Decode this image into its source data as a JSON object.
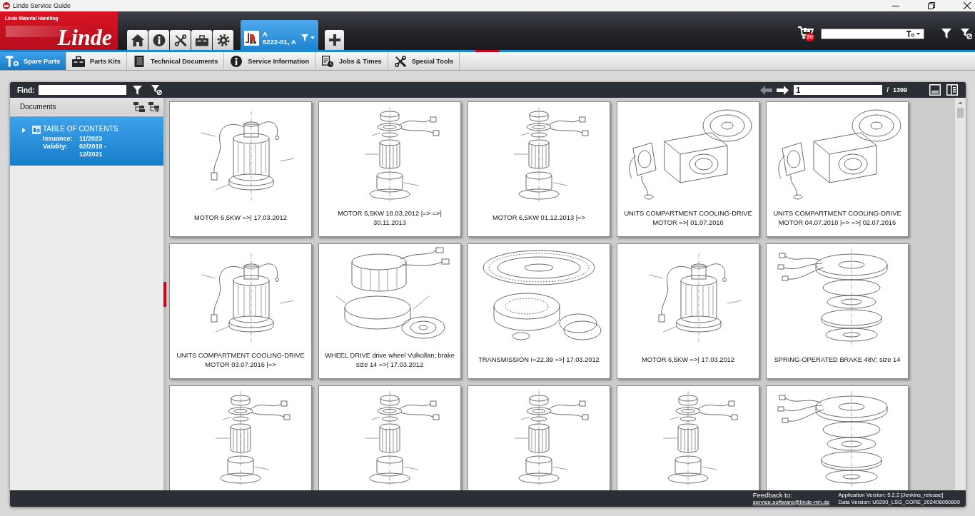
{
  "window": {
    "title": "Linde Service Guide"
  },
  "header": {
    "tagline": "Linde Material Handling",
    "logo": "Linde",
    "vehicle": {
      "model": "A",
      "serial": "5222-01, A"
    },
    "cart_count": "30"
  },
  "tabs": [
    {
      "label": "Spare Parts",
      "selected": true
    },
    {
      "label": "Parts Kits",
      "selected": false
    },
    {
      "label": "Technical Documents",
      "selected": false
    },
    {
      "label": "Service Information",
      "selected": false
    },
    {
      "label": "Jobs & Times",
      "selected": false
    },
    {
      "label": "Special Tools",
      "selected": false
    }
  ],
  "finder": {
    "label": "Find:"
  },
  "pager": {
    "back": {
      "disabled": true
    },
    "forward": {
      "disabled": false
    },
    "page": "1",
    "separator": "/",
    "total": "1399"
  },
  "sidebar": {
    "title": "Documents",
    "items": [
      {
        "title": "TABLE OF CONTENTS",
        "selected": true,
        "expanded": false,
        "fields": [
          {
            "label": "Issuance:",
            "value": "11/2023"
          },
          {
            "label": "Validity:",
            "value": "02/2010 - 12/2021"
          }
        ]
      }
    ]
  },
  "cards": [
    {
      "kind": "motor",
      "caption": "MOTOR 6,5KW =>| 17.03.2012"
    },
    {
      "kind": "stack",
      "caption": "MOTOR 6,5KW 18.03.2012 |=> =>| 30.11.2013"
    },
    {
      "kind": "stack",
      "caption": "MOTOR 6,5KW 01.12.2013 |=>"
    },
    {
      "kind": "housing",
      "caption": "UNITS COMPARTMENT COOLING-DRIVE MOTOR =>| 01.07.2010"
    },
    {
      "kind": "housing",
      "caption": "UNITS COMPARTMENT COOLING-DRIVE MOTOR 04.07.2010 |=> =>| 02.07.2016"
    },
    {
      "kind": "motor",
      "caption": "UNITS COMPARTMENT COOLING-DRIVE MOTOR 03.07.2016 |=>"
    },
    {
      "kind": "drive",
      "caption": "WHEEL DRIVE drive wheel Vulkollan; brake size 14 =>| 17.03.2012"
    },
    {
      "kind": "ring",
      "caption": "TRANSMISSION I=22,39 =>| 17.03.2012"
    },
    {
      "kind": "motor",
      "caption": "MOTOR 6,5KW =>| 17.03.2012"
    },
    {
      "kind": "discs",
      "caption": "SPRING-OPERATED BRAKE 48V; size 14"
    },
    {
      "kind": "stack"
    },
    {
      "kind": "stack"
    },
    {
      "kind": "stack"
    },
    {
      "kind": "stack"
    },
    {
      "kind": "discs"
    }
  ],
  "footer": {
    "feedback_label": "Feedback to:",
    "feedback_email": "service.software@linde-mh.de",
    "app_version": "Application Version: 5.2.2 [Jenkins_release]",
    "data_version": "Data Version: U0290_LSG_CORE_202406050809"
  }
}
